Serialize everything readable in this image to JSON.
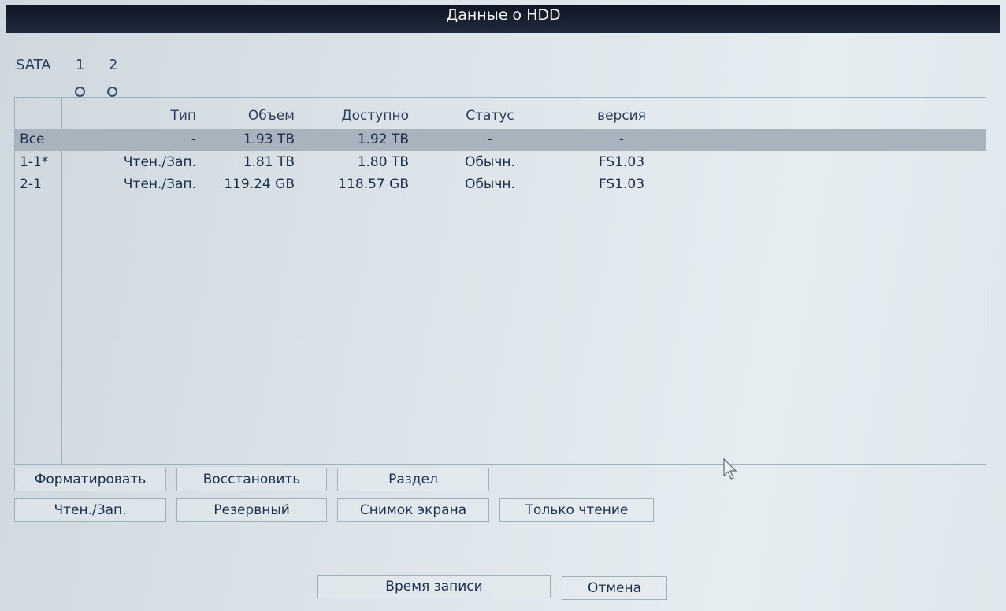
{
  "window": {
    "title": "Данные о HDD"
  },
  "sata": {
    "label": "SATA",
    "ports": [
      "1",
      "2"
    ]
  },
  "table": {
    "headers": {
      "type": "Тип",
      "capacity": "Объем",
      "available": "Доступно",
      "status": "Статус",
      "version": "версия"
    },
    "rows": [
      {
        "id": "Все",
        "type": "-",
        "capacity": "1.93 TB",
        "available": "1.92 TB",
        "status": "-",
        "version": "-",
        "selected": true
      },
      {
        "id": "1-1*",
        "type": "Чтен./Зап.",
        "capacity": "1.81 TB",
        "available": "1.80 TB",
        "status": "Обычн.",
        "version": "FS1.03",
        "selected": false
      },
      {
        "id": "2-1",
        "type": "Чтен./Зап.",
        "capacity": "119.24 GB",
        "available": "118.57 GB",
        "status": "Обычн.",
        "version": "FS1.03",
        "selected": false
      }
    ]
  },
  "buttons": {
    "format": "Форматировать",
    "restore": "Восстановить",
    "partition": "Раздел",
    "read_write": "Чтен./Зап.",
    "backup": "Резервный",
    "snapshot": "Снимок экрана",
    "read_only": "Только чтение",
    "record_time": "Время записи",
    "cancel": "Отмена"
  },
  "colors": {
    "selected_row": "#a9b3bd",
    "titlebar": "#131b28",
    "text": "#1d2f4d"
  },
  "icons": {
    "cursor": "mouse-pointer-icon",
    "sata_indicator": "circle-indicator-icon"
  }
}
